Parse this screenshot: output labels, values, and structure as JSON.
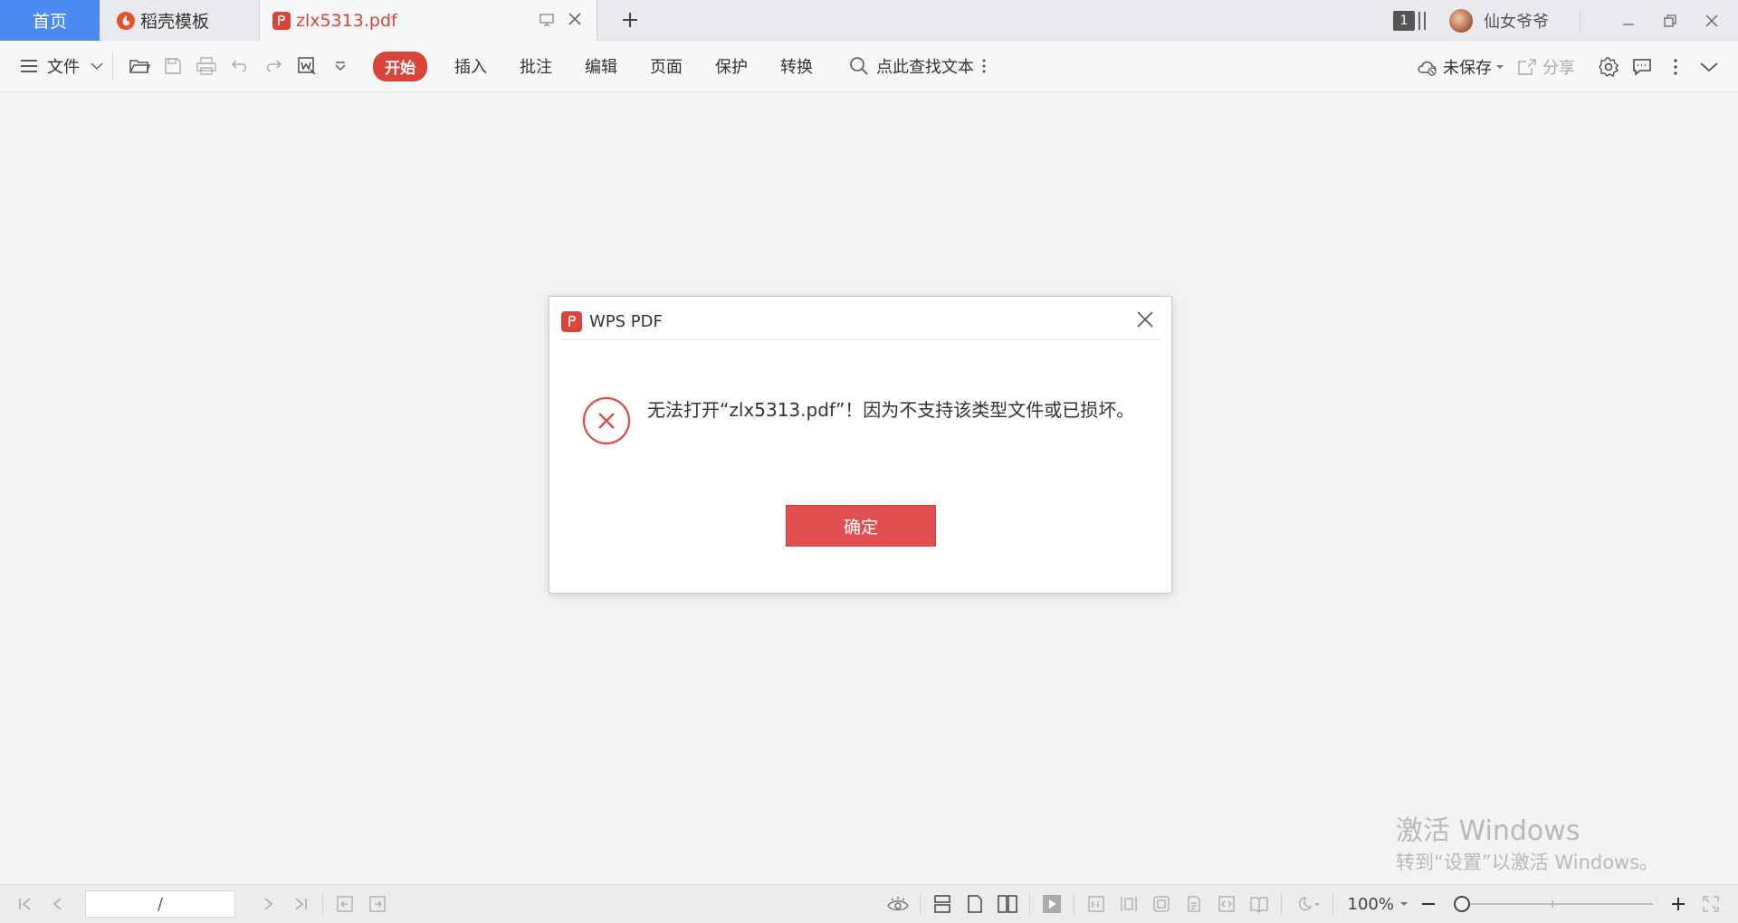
{
  "tabs": {
    "home": "首页",
    "template": "稻壳模板",
    "document": "zlx5313.pdf"
  },
  "titlebar": {
    "window_count": "1",
    "username": "仙女爷爷"
  },
  "toolbar": {
    "file_menu": "文件",
    "tabs": [
      "开始",
      "插入",
      "批注",
      "编辑",
      "页面",
      "保护",
      "转换"
    ],
    "search_label": "点此查找文本",
    "save_status": "未保存",
    "share_label": "分享"
  },
  "dialog": {
    "title": "WPS PDF",
    "message": "无法打开“zlx5313.pdf”！因为不支持该类型文件或已损坏。",
    "ok_label": "确定"
  },
  "watermark": {
    "title": "激活 Windows",
    "subtitle": "转到“设置”以激活 Windows。"
  },
  "statusbar": {
    "page_indicator": "/",
    "zoom": "100%"
  },
  "colors": {
    "accent": "#d9453a",
    "home_tab": "#4b8af3",
    "ok_button": "#e05050"
  }
}
